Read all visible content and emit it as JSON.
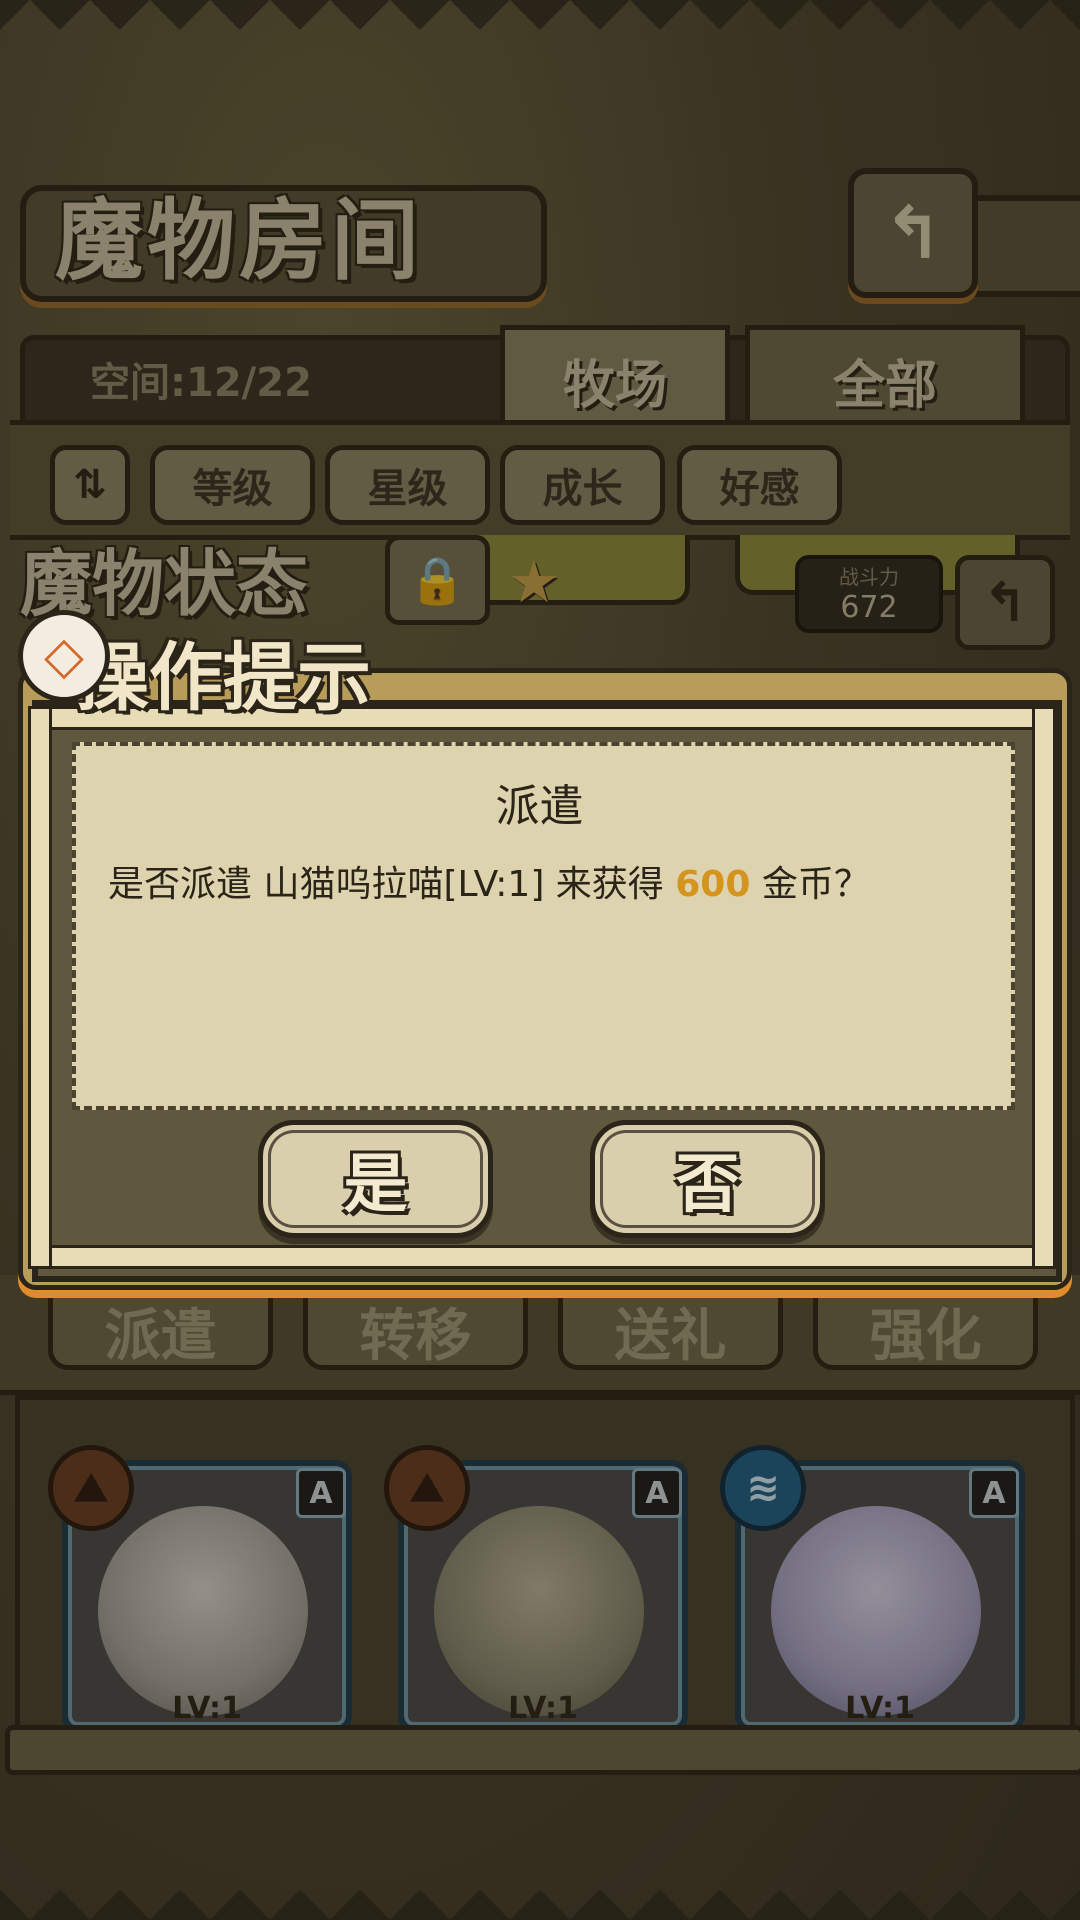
{
  "header": {
    "title": "魔物房间"
  },
  "tabs": {
    "space_text": "空间:12/22",
    "pasture": "牧场",
    "all": "全部"
  },
  "filters": {
    "sort_icon": "sort-toggle-icon",
    "items": [
      "等级",
      "星级",
      "成长",
      "好感"
    ]
  },
  "status": {
    "label": "魔物状态",
    "combat_power_label": "战斗力",
    "combat_power_value": "672"
  },
  "actions": [
    "派遣",
    "转移",
    "送礼",
    "强化"
  ],
  "dialog": {
    "header": "操作提示",
    "title": "派遣",
    "message_prefix": "是否派遣 山猫呜拉喵[LV:1] 来获得 ",
    "gold_amount": "600",
    "message_suffix": " 金币？",
    "yes": "是",
    "no": "否",
    "gold_color": "#d4941e"
  },
  "monsters": [
    {
      "rank": "A",
      "element_icon": "mountain-icon",
      "level": "LV:1"
    },
    {
      "rank": "A",
      "element_icon": "mountain-icon",
      "level": "LV:1"
    },
    {
      "rank": "A",
      "element_icon": "water-icon",
      "level": "LV:1"
    }
  ]
}
